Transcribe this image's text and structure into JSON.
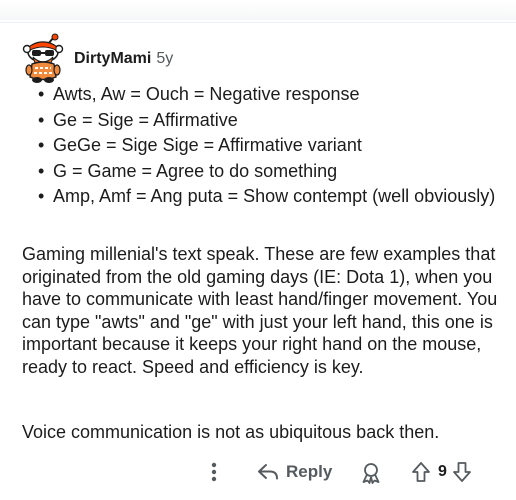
{
  "comment": {
    "username": "DirtyMami",
    "age": "5y",
    "bullets": [
      "Awts, Aw = Ouch = Negative response",
      "Ge = Sige = Affirmative",
      "GeGe = Sige Sige = Affirmative variant",
      "G = Game = Agree to do something",
      "Amp, Amf = Ang puta = Show contempt (well obviously)"
    ],
    "paragraphs": [
      "Gaming millenial's text speak. These are few examples that originated from the old gaming days (IE: Dota 1), when you have to communicate with least hand/finger movement. You can type \"awts\" and \"ge\" with just your left hand, this one is important because it keeps your right hand on the mouse, ready to react. Speed and efficiency is key.",
      "Voice communication is not as ubiquitous back then."
    ]
  },
  "actions": {
    "more_icon": "more-vertical-icon",
    "reply_icon": "reply-arrow-icon",
    "reply_label": "Reply",
    "award_icon": "award-icon",
    "upvote_icon": "upvote-arrow-icon",
    "downvote_icon": "downvote-arrow-icon",
    "score": "9"
  },
  "colors": {
    "text": "#1c1c1c",
    "meta": "#555a5e",
    "avatar_orange": "#ff4500",
    "divider": "#edeff1"
  }
}
